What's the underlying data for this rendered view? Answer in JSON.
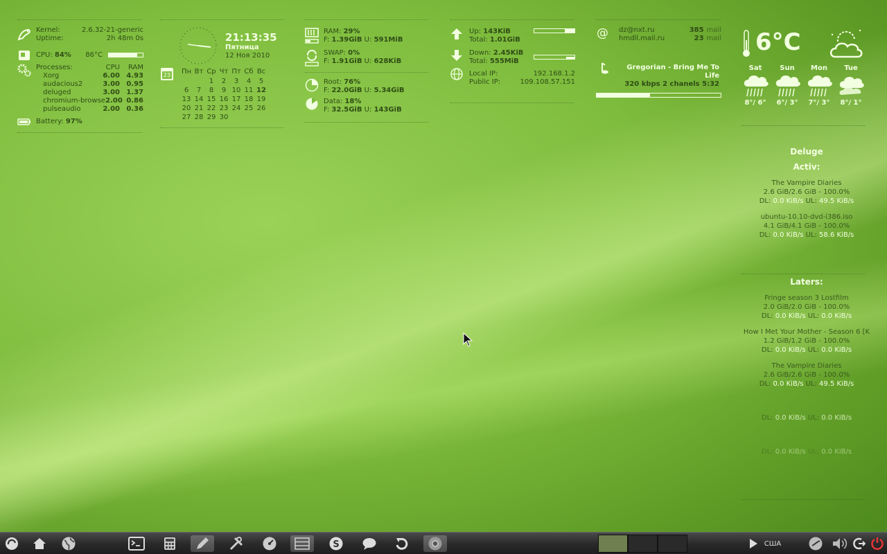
{
  "system": {
    "kernel_label": "Kernel:",
    "kernel_value": "2.6.32-21-generic",
    "uptime_label": "Uptime:",
    "uptime_value": "2h 48m 0s",
    "cpu_label": "CPU:",
    "cpu_value": "84%",
    "temp_value": "86°C",
    "processes_label": "Processes:",
    "col_cpu": "CPU",
    "col_ram": "RAM",
    "processes": [
      {
        "name": "Xorg",
        "cpu": "6.00",
        "ram": "4.93"
      },
      {
        "name": "audacious2",
        "cpu": "3.00",
        "ram": "0.95"
      },
      {
        "name": "deluged",
        "cpu": "3.00",
        "ram": "1.37"
      },
      {
        "name": "chromium-browse",
        "cpu": "2.00",
        "ram": "0.86"
      },
      {
        "name": "pulseaudio",
        "cpu": "2.00",
        "ram": "0.36"
      }
    ],
    "battery_label": "Battery:",
    "battery_value": "97%",
    "cpu_bar_level": 0.84
  },
  "clock": {
    "time": "21:13:35",
    "weekday": "Пятница",
    "date": "12 Ноя 2010",
    "cal_icon_day": "23",
    "weekdays": [
      "Пн",
      "Вт",
      "Ср",
      "Чт",
      "Пт",
      "Сб",
      "Вс"
    ],
    "days": [
      "",
      "",
      "1",
      "2",
      "3",
      "4",
      "5",
      "6",
      "7",
      "8",
      "9",
      "10",
      "11",
      "12",
      "13",
      "14",
      "15",
      "16",
      "17",
      "18",
      "19",
      "20",
      "21",
      "22",
      "23",
      "24",
      "25",
      "26",
      "27",
      "28",
      "29",
      "30"
    ]
  },
  "memory": {
    "ram_label": "RAM:",
    "ram_value": "29%",
    "ram_free_label": "F:",
    "ram_free": "1.39GiB",
    "ram_used_label": "U:",
    "ram_used": "591MiB",
    "swap_label": "SWAP:",
    "swap_value": "0%",
    "swap_free_label": "F:",
    "swap_free": "1.91GiB",
    "swap_used_label": "U:",
    "swap_used": "628KiB",
    "root_label": "Root:",
    "root_value": "76%",
    "root_free_label": "F:",
    "root_free": "22.0GiB",
    "root_used_label": "U:",
    "root_used": "5.34GiB",
    "data_label": "Data:",
    "data_value": "18%",
    "data_free_label": "F:",
    "data_free": "32.5GiB",
    "data_used_label": "U:",
    "data_used": "143GiB"
  },
  "network": {
    "up_label": "Up:",
    "up_value": "143KiB",
    "up_total_label": "Total:",
    "up_total": "1.01GiB",
    "down_label": "Down:",
    "down_value": "2.45KiB",
    "down_total_label": "Total:",
    "down_total": "555MiB",
    "local_ip_label": "Local IP:",
    "local_ip": "192.168.1.2",
    "public_ip_label": "Public IP:",
    "public_ip": "109.108.57.151"
  },
  "mail": {
    "at_symbol": "@",
    "accounts": [
      {
        "address": "dz@nxt.ru",
        "count": "385",
        "unit": "mail"
      },
      {
        "address": "hmdll.mail.ru",
        "count": "23",
        "unit": "mail"
      }
    ]
  },
  "music": {
    "track": "Gregorian - Bring Me To Life",
    "info": "320 kbps  2 chanels 5:32",
    "progress": 0.43
  },
  "weather": {
    "temp": "6°C",
    "forecast": [
      {
        "day": "Sat",
        "temps": "8°/ 6°"
      },
      {
        "day": "Sun",
        "temps": "6°/ 3°"
      },
      {
        "day": "Mon",
        "temps": "7°/ 3°"
      },
      {
        "day": "Tue",
        "temps": "8°/ 1°"
      }
    ]
  },
  "deluge": {
    "title": "Deluge",
    "active_label": "Activ:",
    "later_label": "Laters:",
    "dl_label": "DL:",
    "ul_label": "UL:",
    "active": [
      {
        "name": "The Vampire Diaries",
        "size": "2.6 GiB/2.6 GiB - 100.0%",
        "dl": "0.0 KiB/s",
        "ul": "49.5 KiB/s"
      },
      {
        "name": "ubuntu-10.10-dvd-i386.iso",
        "size": "4.1 GiB/4.1 GiB - 100.0%",
        "dl": "0.0 KiB/s",
        "ul": "58.6 KiB/s"
      }
    ],
    "later": [
      {
        "name": "Fringe season 3 Lostfilm",
        "size": "2.0 GiB/2.0 GiB - 100.0%",
        "dl": "0.0 KiB/s",
        "ul": "0.0 KiB/s"
      },
      {
        "name": "How I Met Your Mother - Season 6 [K",
        "size": "1.2 GiB/1.2 GiB - 100.0%",
        "dl": "0.0 KiB/s",
        "ul": "0.0 KiB/s"
      },
      {
        "name": "The Vampire Diaries",
        "size": "2.6 GiB/2.6 GiB - 100.0%",
        "dl": "0.0 KiB/s",
        "ul": "49.5 KiB/s"
      },
      {
        "name": "",
        "size": "",
        "dl": "0.0 KiB/s",
        "ul": "0.0 KiB/s"
      },
      {
        "name": "",
        "size": "",
        "dl": "0.0 KiB/s",
        "ul": "0.0 KiB/s"
      }
    ]
  },
  "taskbar": {
    "keyboard_layout": "США"
  },
  "colors": {
    "accent": "#f2ffe0",
    "text": "#2f4d16",
    "taskbar": "#2b2b2b"
  }
}
